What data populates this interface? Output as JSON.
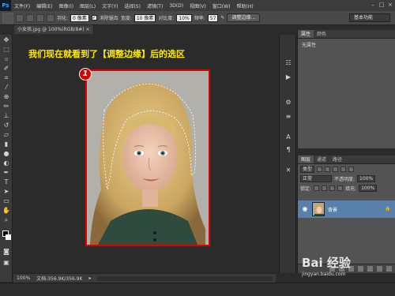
{
  "menubar": {
    "logo": "Ps",
    "items": [
      "文件(F)",
      "编辑(E)",
      "图像(I)",
      "图层(L)",
      "文字(Y)",
      "选择(S)",
      "滤镜(T)",
      "3D(D)",
      "视图(V)",
      "窗口(W)",
      "帮助(H)"
    ]
  },
  "options": {
    "feather_label": "羽化:",
    "feather_value": "0 像素",
    "antialias_label": "消除锯齿",
    "style_label": "宽度:",
    "style_value": "10 像素",
    "contrast_label": "对比度:",
    "contrast_value": "10%",
    "frequency_label": "频率:",
    "frequency_value": "57",
    "refine_button": "调整边缘...",
    "workspace": "基本功能"
  },
  "document": {
    "tab_label": "小女孩.jpg @ 100%(RGB/8#) ×",
    "caption": "我们现在就看到了【调整边缘】后的选区",
    "step_number": "1"
  },
  "status": {
    "zoom": "100%",
    "doc_info": "文档:356.9K/356.9K"
  },
  "properties": {
    "tabs": [
      "属性",
      "颜色"
    ],
    "empty_text": "无属性"
  },
  "layers": {
    "tabs": [
      "图层",
      "通道",
      "路径"
    ],
    "kind_label": "类型",
    "blend_mode": "正常",
    "opacity_label": "不透明度:",
    "opacity_value": "100%",
    "lock_label": "锁定:",
    "fill_label": "填充:",
    "fill_value": "100%",
    "layer_name": "背景"
  },
  "watermark": {
    "logo": "Bai 经验",
    "url": "jingyan.baidu.com"
  },
  "colors": {
    "accent_red": "#e00000",
    "caption_yellow": "#ffeb00",
    "layer_selected": "#5880ab"
  }
}
